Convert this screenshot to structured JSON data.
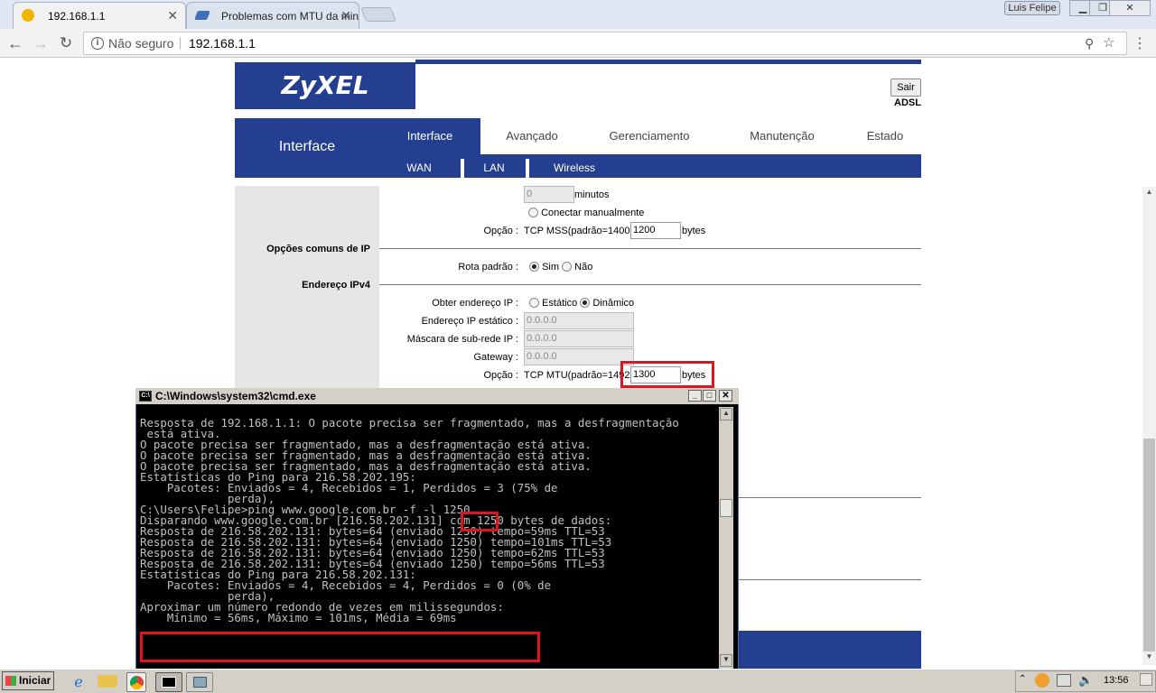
{
  "browser": {
    "tabs": [
      {
        "title": "192.168.1.1"
      },
      {
        "title": "Problemas com MTU da min"
      }
    ],
    "user_name": "Luis Felipe",
    "security_label": "Não seguro",
    "url": "192.168.1.1"
  },
  "router": {
    "brand": "ZyXEL",
    "logout_label": "Sair",
    "product_label": "ADSL",
    "section_title": "Interface",
    "main_tabs": [
      "Interface",
      "Avançado",
      "Gerenciamento",
      "Manutenção",
      "Estado"
    ],
    "sub_tabs": [
      "WAN",
      "LAN",
      "Wireless"
    ],
    "idle_value": "0",
    "idle_unit": "minutos",
    "manual_connect_label": "Conectar manualmente",
    "mss_label": "Opção :",
    "mss_text": "TCP MSS(padrão=1400):",
    "mss_value": "1200",
    "bytes_label": "bytes",
    "common_ip_options": "Opções comuns de IP",
    "default_route_label": "Rota padrão :",
    "yes_label": "Sim",
    "no_label": "Não",
    "ipv4_address": "Endereço IPv4",
    "obtain_ip_label": "Obter endereço IP :",
    "static_label": "Estático",
    "dynamic_label": "Dinâmico",
    "static_ip_label": "Endereço IP estático :",
    "static_ip_value": "0.0.0.0",
    "subnet_label": "Máscara de sub-rede IP :",
    "subnet_value": "0.0.0.0",
    "gateway_label": "Gateway :",
    "gateway_value": "0.0.0.0",
    "mtu_label": "Opção :",
    "mtu_text": "TCP MTU(padrão=1492):",
    "mtu_value": "1300"
  },
  "cmd": {
    "title": "C:\\Windows\\system32\\cmd.exe",
    "lines": [
      "Resposta de 192.168.1.1: O pacote precisa ser fragmentado, mas a desfragmentação",
      " está ativa.",
      "O pacote precisa ser fragmentado, mas a desfragmentação está ativa.",
      "O pacote precisa ser fragmentado, mas a desfragmentação está ativa.",
      "O pacote precisa ser fragmentado, mas a desfragmentação está ativa.",
      "",
      "Estatísticas do Ping para 216.58.202.195:",
      "    Pacotes: Enviados = 4, Recebidos = 1, Perdidos = 3 (75% de",
      "             perda),",
      "",
      "C:\\Users\\Felipe>ping www.google.com.br -f -l 1250",
      "",
      "Disparando www.google.com.br [216.58.202.131] com 1250 bytes de dados:",
      "Resposta de 216.58.202.131: bytes=64 (enviado 1250) tempo=59ms TTL=53",
      "Resposta de 216.58.202.131: bytes=64 (enviado 1250) tempo=101ms TTL=53",
      "Resposta de 216.58.202.131: bytes=64 (enviado 1250) tempo=62ms TTL=53",
      "Resposta de 216.58.202.131: bytes=64 (enviado 1250) tempo=56ms TTL=53",
      "",
      "Estatísticas do Ping para 216.58.202.131:",
      "    Pacotes: Enviados = 4, Recebidos = 4, Perdidos = 0 (0% de",
      "             perda),",
      "Aproximar um número redondo de vezes em milissegundos:",
      "    Mínimo = 56ms, Máximo = 101ms, Média = 69ms"
    ]
  },
  "taskbar": {
    "start_label": "Iniciar",
    "clock": "13:56"
  },
  "colors": {
    "router_blue": "#243f8f",
    "highlight_red": "#e0141e"
  }
}
